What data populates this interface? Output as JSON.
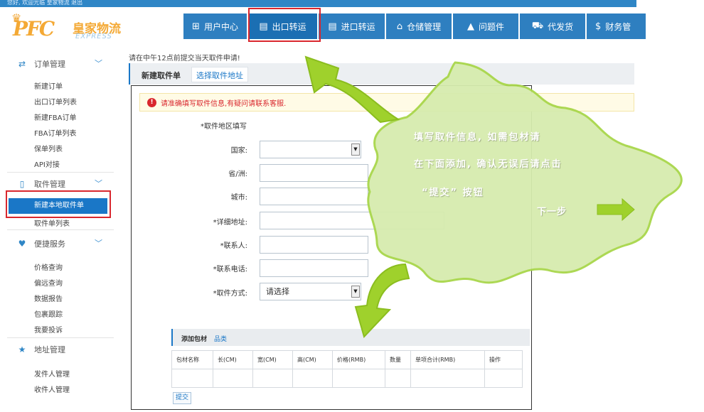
{
  "top_bar": {
    "text": "您好, 欢迎光临 皇家物流 退出"
  },
  "logo": {
    "crown_icon": "crown-icon",
    "mark": "PFC",
    "chinese": "皇家物流",
    "english": "EXPRESS"
  },
  "nav": [
    {
      "label": "用户中心",
      "icon": "⊞",
      "active": false
    },
    {
      "label": "出口转运",
      "icon": "▤",
      "active": true
    },
    {
      "label": "进口转运",
      "icon": "▤",
      "active": false
    },
    {
      "label": "仓储管理",
      "icon": "⌂",
      "active": false
    },
    {
      "label": "问题件",
      "icon": "▲",
      "active": false
    },
    {
      "label": "代发货",
      "icon": "⛟",
      "active": false
    },
    {
      "label": "财务管",
      "icon": "$",
      "active": false
    }
  ],
  "sidebar": {
    "sections": [
      {
        "title": "订单管理",
        "icon": "⇄",
        "items": [
          "新建订单",
          "出口订单列表",
          "新建FBA订单",
          "FBA订单列表",
          "保单列表",
          "API对接"
        ]
      },
      {
        "title": "取件管理",
        "icon": "▯",
        "items": [
          "新建本地取件单",
          "取件单列表"
        ]
      },
      {
        "title": "便捷服务",
        "icon": "♥",
        "items": [
          "价格查询",
          "偏远查询",
          "数据报告",
          "包裹跟踪",
          "我要投诉"
        ]
      },
      {
        "title": "地址管理",
        "icon": "★",
        "items": [
          "发件人管理",
          "收件人管理"
        ]
      }
    ],
    "active_item": "新建本地取件单"
  },
  "notice": "请在中午12点前提交当天取件申请!",
  "tabs": {
    "active": "新建取件单",
    "other": "选择取件地址"
  },
  "warning": "请准确填写取件信息,有疑问请联系客服.",
  "form": {
    "section_title": "*取件地区填写",
    "country_label": "国家:",
    "province_label": "省/洲:",
    "city_label": "城市:",
    "address_label": "*详细地址:",
    "contact_label": "*联系人:",
    "phone_label": "*联系电话:",
    "pickup_method_label": "*取件方式:",
    "pickup_method_value": "请选择"
  },
  "packaging": {
    "title": "添加包材",
    "link": "品类",
    "columns": [
      "包材名称",
      "长(CM)",
      "宽(CM)",
      "高(CM)",
      "价格(RMB)",
      "数量",
      "单项合计(RMB)",
      "操作"
    ],
    "submit_label": "提交"
  },
  "callout": {
    "line1": "填写取件信息, 如需包材请",
    "line2": "在下面添加, 确认无误后请点击",
    "line3": "“提交” 按钮",
    "next": "下一步",
    "cloud_color": "#d6ecae",
    "arrow_color": "#9fd12c"
  }
}
